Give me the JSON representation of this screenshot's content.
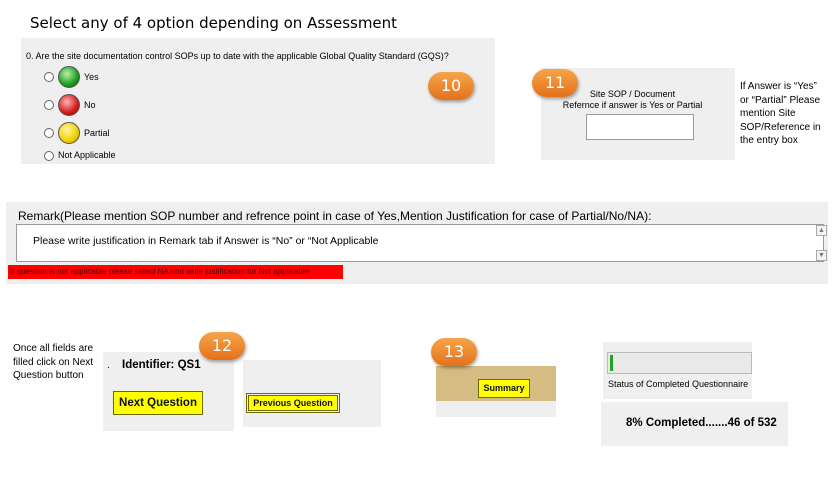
{
  "heading": "Select any of 4 option depending on Assessment",
  "question": {
    "text": "0. Are the site documentation control SOPs up to date with the applicable Global Quality Standard (GQS)?",
    "options": [
      "Yes",
      "No",
      "Partial",
      "Not Applicable"
    ]
  },
  "badges": [
    "10",
    "11",
    "12",
    "13"
  ],
  "sop": {
    "label_line1": "Site SOP / Document",
    "label_line2": "Refernce if answer is Yes or Partial",
    "value": ""
  },
  "note_sop": [
    "If Answer is “Yes”",
    "or “Partial” Please",
    "mention Site",
    "SOP/Reference in",
    "the entry box"
  ],
  "remark": {
    "label": "Remark(Please mention SOP number and refrence point in case of Yes,Mention Justification for case of Partial/No/NA):",
    "text": "Please write justification in Remark tab if Answer is “No” or “Not Applicable",
    "warning": "If question is not applicable please select NA and write justification for Not applicable"
  },
  "note_next": [
    "Once all fields are",
    "filled click on Next",
    "Question button"
  ],
  "identifier_dot": ".",
  "identifier": "Identifier: QS1",
  "buttons": {
    "next": "Next Question",
    "previous": "Previous Question",
    "summary": "Summary"
  },
  "status": {
    "label": "Status of Completed Questionnaire",
    "progress_fraction": 0.086,
    "completed_text": "8% Completed.......46 of 532"
  },
  "colors": {
    "badge": "#e97c24",
    "yellow_button": "#ffff00",
    "warning_bg": "#ff0000",
    "summary_bar": "#d4bc82",
    "progress": "#1fa51f"
  }
}
